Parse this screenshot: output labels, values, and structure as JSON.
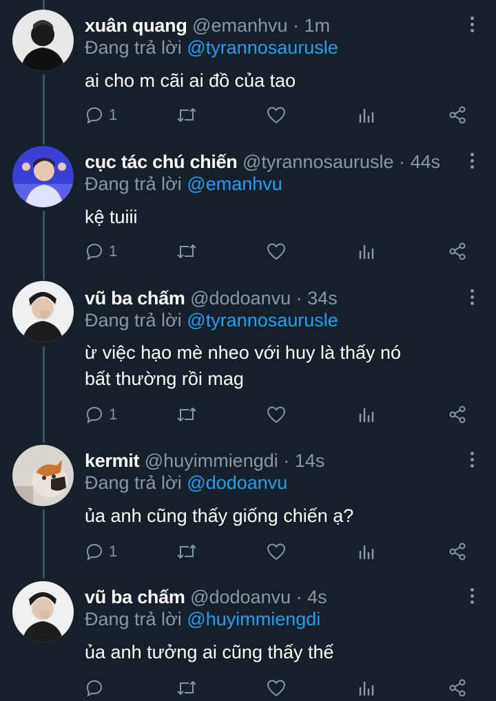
{
  "tweets": [
    {
      "name": "xuân quang",
      "handle": "@emanhvu",
      "time": "1m",
      "reply_prefix": "Đang trả lời",
      "reply_to": "@tyrannosaurusle",
      "text": "ai cho m cãi ai đồ của tao",
      "reply_count": "1"
    },
    {
      "name": "cục tác chú chiến",
      "handle": "@tyrannosaurusle",
      "time": "44s",
      "reply_prefix": "Đang trả lời",
      "reply_to": "@emanhvu",
      "text": "kệ tuiii",
      "reply_count": "1"
    },
    {
      "name": "vũ ba chấm",
      "handle": "@dodoanvu",
      "time": "34s",
      "reply_prefix": "Đang trả lời",
      "reply_to": "@tyrannosaurusle",
      "text": "ừ việc hạo mè nheo với huy là thấy nó bất thường rồi mag",
      "reply_count": "1"
    },
    {
      "name": "kermit",
      "handle": "@huyimmiengdi",
      "time": "14s",
      "reply_prefix": "Đang trả lời",
      "reply_to": "@dodoanvu",
      "text": "ủa anh cũng thấy giống chiến ạ?",
      "reply_count": "1"
    },
    {
      "name": "vũ ba chấm",
      "handle": "@dodoanvu",
      "time": "4s",
      "reply_prefix": "Đang trả lời",
      "reply_to": "@huyimmiengdi",
      "text": "ủa anh tưởng ai cũng thấy thế",
      "reply_count": ""
    }
  ],
  "separator": "·",
  "icons": [
    "reply-icon",
    "retweet-icon",
    "like-icon",
    "analytics-icon",
    "share-icon",
    "more-icon"
  ],
  "colors": {
    "background": "#15202b",
    "secondary_text": "#8899a6",
    "link": "#1da1f2",
    "thread_line": "#3d5466"
  }
}
